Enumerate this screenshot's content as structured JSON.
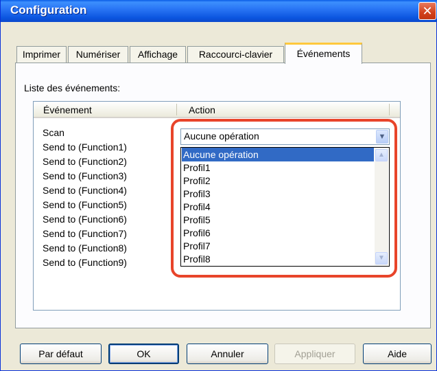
{
  "window": {
    "title": "Configuration",
    "close_glyph": "✕"
  },
  "tabs": [
    {
      "label": "Imprimer",
      "active": false
    },
    {
      "label": "Numériser",
      "active": false
    },
    {
      "label": "Affichage",
      "active": false
    },
    {
      "label": "Raccourci-clavier",
      "active": false
    },
    {
      "label": "Événements",
      "active": true
    }
  ],
  "events_panel": {
    "list_label": "Liste des événements:",
    "columns": {
      "event": "Événement",
      "action": "Action"
    },
    "events": [
      "Scan",
      "Send to (Function1)",
      "Send to (Function2)",
      "Send to (Function3)",
      "Send to (Function4)",
      "Send to (Function5)",
      "Send to (Function6)",
      "Send to (Function7)",
      "Send to (Function8)",
      "Send to (Function9)"
    ],
    "action_combo": {
      "value": "Aucune opération",
      "options": [
        "Aucune opération",
        "Profil1",
        "Profil2",
        "Profil3",
        "Profil4",
        "Profil5",
        "Profil6",
        "Profil7",
        "Profil8"
      ],
      "selected_option": "Aucune opération"
    },
    "highlight_color": "#e8442a"
  },
  "buttons": {
    "default": "Par défaut",
    "ok": "OK",
    "cancel": "Annuler",
    "apply": "Appliquer",
    "help": "Aide"
  },
  "icons": {
    "close": "close-icon",
    "combo_arrow": "chevron-down-icon",
    "scroll_up": "chevron-up-icon",
    "scroll_down": "chevron-down-icon"
  }
}
